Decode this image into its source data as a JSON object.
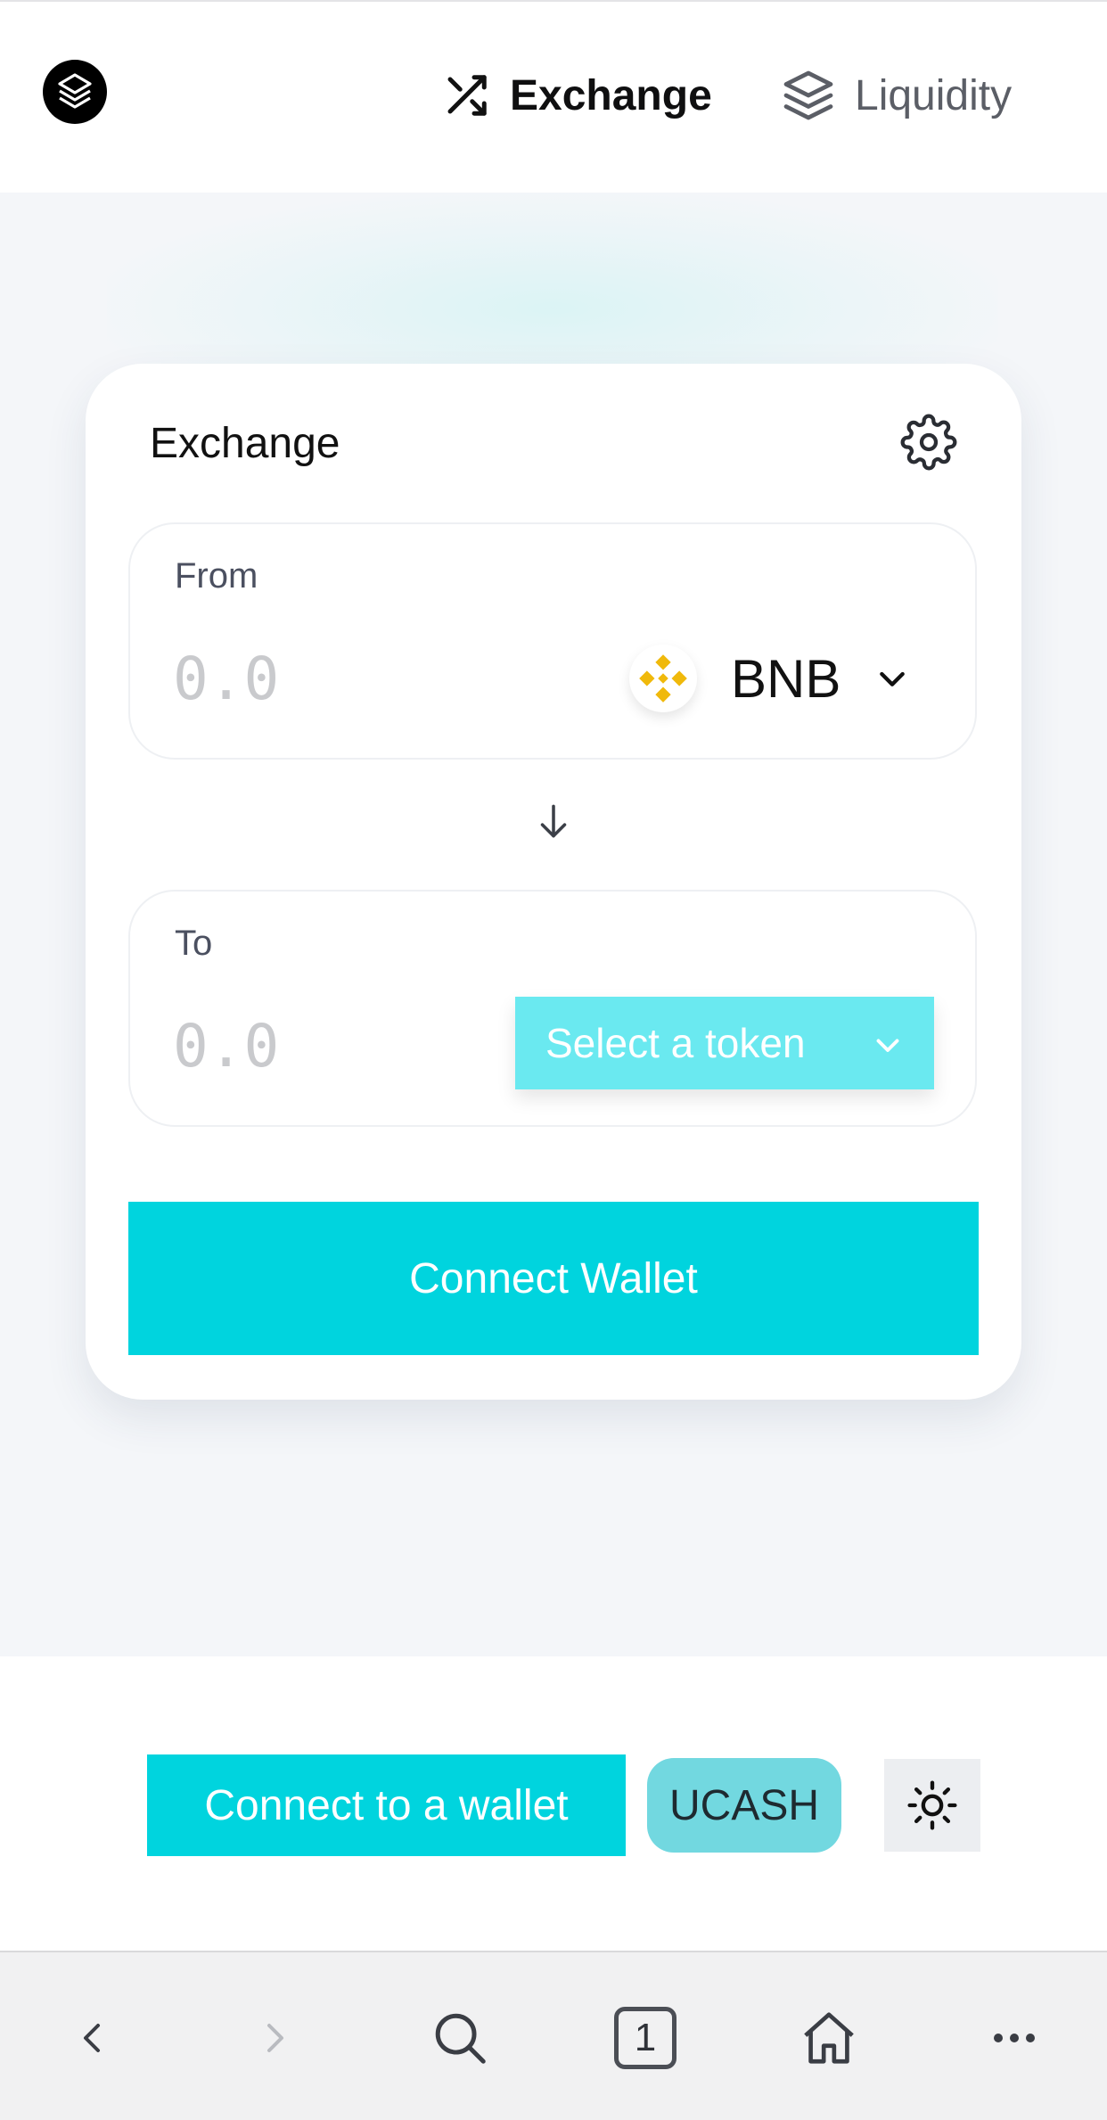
{
  "header": {
    "logo": "logo-icon",
    "nav": {
      "exchange": {
        "label": "Exchange",
        "icon": "shuffle-icon",
        "active": true
      },
      "liquidity": {
        "label": "Liquidity",
        "icon": "layers-icon",
        "active": false
      }
    }
  },
  "exchange_card": {
    "title": "Exchange",
    "settings_icon": "gear-icon",
    "from": {
      "label": "From",
      "amount_value": "",
      "amount_placeholder": "0.0",
      "token_symbol": "BNB",
      "token_icon": "bnb-icon"
    },
    "swap_direction_icon": "arrow-down-icon",
    "to": {
      "label": "To",
      "amount_value": "",
      "amount_placeholder": "0.0",
      "select_label": "Select a token"
    },
    "connect_wallet_label": "Connect Wallet"
  },
  "footer": {
    "connect_label": "Connect to a wallet",
    "token_badge": "UCASH",
    "theme_icon": "sun-icon"
  },
  "browser_bar": {
    "tab_count": "1",
    "icons": [
      "back-icon",
      "forward-icon",
      "search-icon",
      "tabs-icon",
      "home-icon",
      "more-icon"
    ]
  },
  "colors": {
    "accent": "#00d4de",
    "accent_light": "#6ae9f0",
    "badge": "#72d8e0",
    "bnb": "#f0b90b",
    "page_bg": "#f4f6f9"
  }
}
